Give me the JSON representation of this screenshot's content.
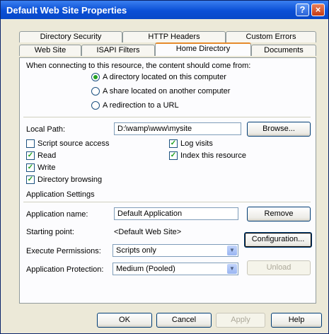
{
  "window": {
    "title": "Default Web Site Properties",
    "help_btn": "?",
    "close_btn": "×"
  },
  "tabs_row1": [
    "Directory Security",
    "HTTP Headers",
    "Custom Errors"
  ],
  "tabs_row2": [
    "Web Site",
    "ISAPI Filters",
    "Home Directory",
    "Documents"
  ],
  "content": {
    "intro": "When connecting to this resource, the content should come from:",
    "radios": [
      {
        "label": "A directory located on this computer",
        "selected": true
      },
      {
        "label": "A share located on another computer",
        "selected": false
      },
      {
        "label": "A redirection to a URL",
        "selected": false
      }
    ],
    "local_path_label": "Local Path:",
    "local_path_value": "D:\\wamp\\www\\mysite",
    "browse": "Browse...",
    "checks_left": [
      {
        "label": "Script source access",
        "checked": false
      },
      {
        "label": "Read",
        "checked": true
      },
      {
        "label": "Write",
        "checked": true
      },
      {
        "label": "Directory browsing",
        "checked": true
      }
    ],
    "checks_right": [
      {
        "label": "Log visits",
        "checked": true
      },
      {
        "label": "Index this resource",
        "checked": true
      }
    ],
    "app_settings": "Application Settings",
    "app_name_label": "Application name:",
    "app_name_value": "Default Application",
    "remove": "Remove",
    "starting_point_label": "Starting point:",
    "starting_point_value": "<Default Web Site>",
    "configuration": "Configuration...",
    "exec_perm_label": "Execute Permissions:",
    "exec_perm_value": "Scripts only",
    "app_prot_label": "Application Protection:",
    "app_prot_value": "Medium (Pooled)",
    "unload": "Unload"
  },
  "footer": {
    "ok": "OK",
    "cancel": "Cancel",
    "apply": "Apply",
    "help": "Help"
  }
}
